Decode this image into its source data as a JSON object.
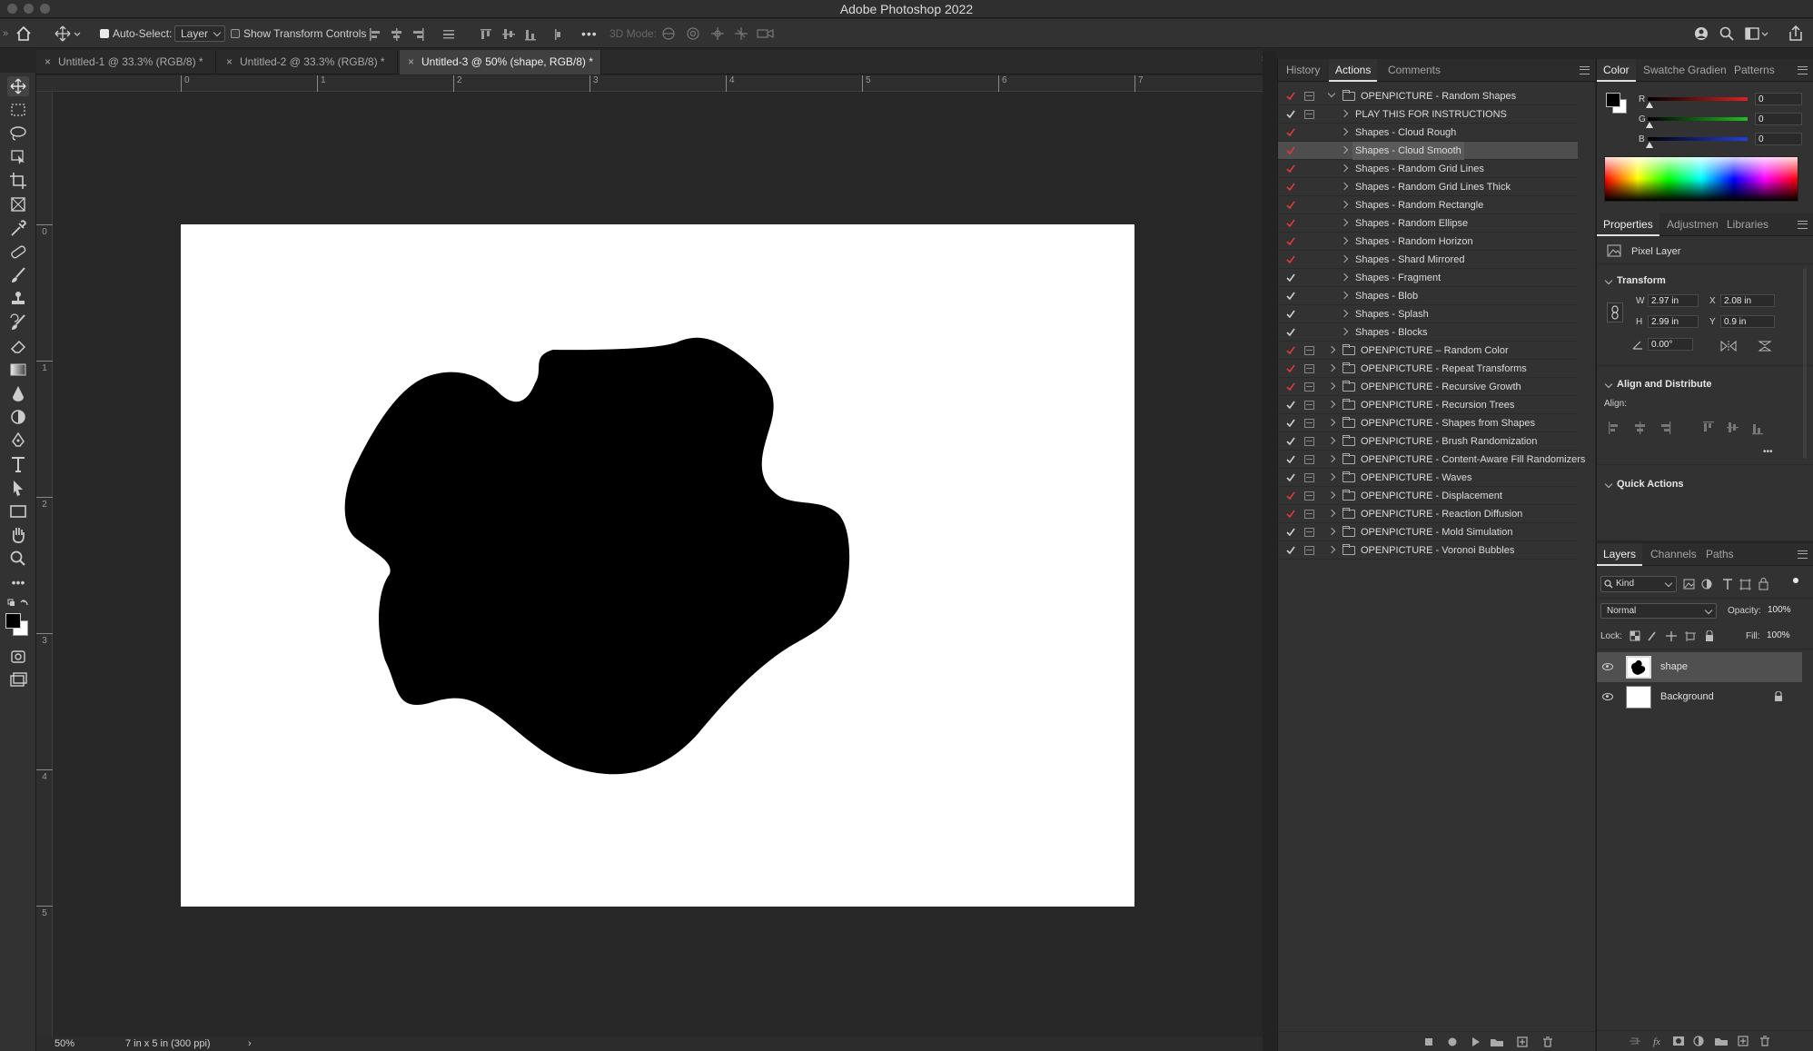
{
  "app": {
    "title": "Adobe Photoshop 2022"
  },
  "options_bar": {
    "auto_select_label": "Auto-Select:",
    "auto_select_value": "Layer",
    "show_transform_label": "Show Transform Controls",
    "mode_3d_label": "3D Mode:"
  },
  "doc_tabs": [
    {
      "label": "Untitled-1 @ 33.3% (RGB/8) *"
    },
    {
      "label": "Untitled-2 @ 33.3% (RGB/8) *"
    },
    {
      "label": "Untitled-3 @ 50% (shape, RGB/8) *"
    }
  ],
  "rulers": {
    "h": [
      "0",
      "1",
      "2",
      "3",
      "4",
      "5",
      "6",
      "7"
    ],
    "v": [
      "0",
      "1",
      "2",
      "3",
      "4",
      "5"
    ]
  },
  "status": {
    "zoom": "50%",
    "doc_info": "7 in x 5 in (300 ppi)",
    "arrow": "›"
  },
  "actions_panel": {
    "tabs": [
      "History",
      "Actions",
      "Comments"
    ],
    "active_tab": "Actions",
    "items": [
      {
        "label": "OPENPICTURE - Random Shapes",
        "type": "set",
        "open": true,
        "red": true,
        "dialog": true
      },
      {
        "label": "PLAY THIS FOR INSTRUCTIONS",
        "type": "action",
        "red": false,
        "dialog": true
      },
      {
        "label": "Shapes - Cloud Rough",
        "type": "action",
        "red": true,
        "dialog": false
      },
      {
        "label": "Shapes - Cloud Smooth",
        "type": "action",
        "red": true,
        "dialog": false,
        "selected": true
      },
      {
        "label": "Shapes - Random Grid Lines",
        "type": "action",
        "red": true,
        "dialog": false
      },
      {
        "label": "Shapes - Random Grid Lines Thick",
        "type": "action",
        "red": true,
        "dialog": false
      },
      {
        "label": "Shapes - Random Rectangle",
        "type": "action",
        "red": true,
        "dialog": false
      },
      {
        "label": "Shapes - Random Ellipse",
        "type": "action",
        "red": true,
        "dialog": false
      },
      {
        "label": "Shapes - Random Horizon",
        "type": "action",
        "red": true,
        "dialog": false
      },
      {
        "label": "Shapes - Shard Mirrored",
        "type": "action",
        "red": true,
        "dialog": false
      },
      {
        "label": "Shapes - Fragment",
        "type": "action",
        "red": false,
        "dialog": false
      },
      {
        "label": "Shapes - Blob",
        "type": "action",
        "red": false,
        "dialog": false
      },
      {
        "label": "Shapes - Splash",
        "type": "action",
        "red": false,
        "dialog": false
      },
      {
        "label": "Shapes - Blocks",
        "type": "action",
        "red": false,
        "dialog": false
      },
      {
        "label": "OPENPICTURE – Random Color",
        "type": "set",
        "red": true,
        "dialog": true
      },
      {
        "label": "OPENPICTURE - Repeat Transforms",
        "type": "set",
        "red": true,
        "dialog": true
      },
      {
        "label": "OPENPICTURE - Recursive Growth",
        "type": "set",
        "red": true,
        "dialog": true
      },
      {
        "label": "OPENPICTURE - Recursion Trees",
        "type": "set",
        "red": false,
        "dialog": true
      },
      {
        "label": "OPENPICTURE - Shapes from Shapes",
        "type": "set",
        "red": false,
        "dialog": true
      },
      {
        "label": "OPENPICTURE - Brush Randomization",
        "type": "set",
        "red": false,
        "dialog": true
      },
      {
        "label": "OPENPICTURE - Content-Aware Fill Randomizers",
        "type": "set",
        "red": false,
        "dialog": true
      },
      {
        "label": "OPENPICTURE - Waves",
        "type": "set",
        "red": false,
        "dialog": true
      },
      {
        "label": "OPENPICTURE - Displacement",
        "type": "set",
        "red": true,
        "dialog": true
      },
      {
        "label": "OPENPICTURE - Reaction Diffusion",
        "type": "set",
        "red": true,
        "dialog": true
      },
      {
        "label": "OPENPICTURE - Mold Simulation",
        "type": "set",
        "red": false,
        "dialog": true
      },
      {
        "label": "OPENPICTURE - Voronoi Bubbles",
        "type": "set",
        "red": false,
        "dialog": true
      }
    ]
  },
  "color_panel": {
    "tabs": [
      "Color",
      "Swatche",
      "Gradien",
      "Patterns"
    ],
    "channels": [
      {
        "name": "R",
        "value": "0",
        "color": "#e02020"
      },
      {
        "name": "G",
        "value": "0",
        "color": "#20c020"
      },
      {
        "name": "B",
        "value": "0",
        "color": "#2040e0"
      }
    ],
    "foreground": "#000000",
    "background": "#ffffff"
  },
  "properties_panel": {
    "tabs": [
      "Properties",
      "Adjustmen",
      "Libraries"
    ],
    "layer_type": "Pixel Layer",
    "transform_title": "Transform",
    "w_label": "W",
    "w": "2.97 in",
    "x_label": "X",
    "x": "2.08 in",
    "h_label": "H",
    "h": "2.99 in",
    "y_label": "Y",
    "y": "0.9 in",
    "angle": "0.00°",
    "align_title": "Align and Distribute",
    "align_label": "Align:",
    "more": "•••",
    "quick_actions_title": "Quick Actions"
  },
  "layers_panel": {
    "tabs": [
      "Layers",
      "Channels",
      "Paths"
    ],
    "filter_kind": "Kind",
    "blend_mode": "Normal",
    "opacity_label": "Opacity:",
    "opacity": "100%",
    "lock_label": "Lock:",
    "fill_label": "Fill:",
    "fill": "100%",
    "layers": [
      {
        "name": "shape",
        "selected": true
      },
      {
        "name": "Background",
        "locked": true
      }
    ]
  }
}
